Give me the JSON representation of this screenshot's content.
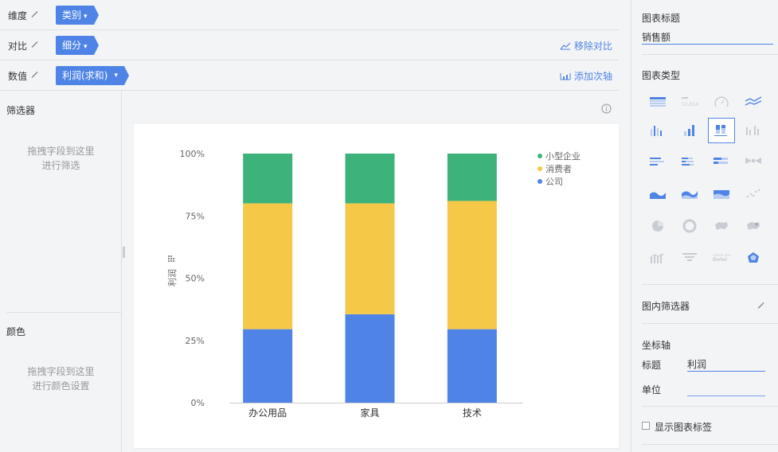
{
  "rows": {
    "dimension": {
      "label": "维度",
      "pill": "类别"
    },
    "compare": {
      "label": "对比",
      "pill": "细分",
      "action": "移除对比"
    },
    "value": {
      "label": "数值",
      "pill": "利润(求和)",
      "action": "添加次轴"
    }
  },
  "filter": {
    "title": "筛选器",
    "hint1": "拖拽字段到这里",
    "hint2": "进行筛选"
  },
  "color": {
    "title": "颜色",
    "hint1": "拖拽字段到这里",
    "hint2": "进行颜色设置"
  },
  "right": {
    "chart_title_label": "图表标题",
    "chart_title_value": "销售额",
    "chart_type_label": "图表类型",
    "inner_filter_label": "图内筛选器",
    "axis_label": "坐标轴",
    "axis_title_label": "标题",
    "axis_title_value": "利润",
    "unit_label": "单位",
    "unit_value": "",
    "show_labels": "显示图表标签",
    "chart_types": [
      "table",
      "kpi",
      "gauge",
      "line",
      "bar",
      "bar-grouped",
      "stacked-bar-100",
      "bar-dim",
      "hbar",
      "hbar-stacked",
      "hbar-100",
      "butterfly",
      "area",
      "area-stacked",
      "area-100",
      "scatter",
      "pie",
      "donut",
      "map",
      "map-bubble",
      "histogram",
      "funnel",
      "wordcloud",
      "radar"
    ],
    "selected_type": "stacked-bar-100"
  },
  "colors": {
    "accent": "#4f84e6",
    "green": "#3eb27b",
    "yellow": "#f5c848",
    "blue": "#4f84e6"
  },
  "chart_data": {
    "type": "bar",
    "stacked": true,
    "normalized": true,
    "categories": [
      "办公用品",
      "家具",
      "技术"
    ],
    "series": [
      {
        "name": "公司",
        "color": "#4f84e6",
        "values": [
          29.5,
          35.5,
          29.5
        ]
      },
      {
        "name": "消费者",
        "color": "#f5c848",
        "values": [
          50.5,
          44.5,
          51.5
        ]
      },
      {
        "name": "小型企业",
        "color": "#3eb27b",
        "values": [
          20,
          20,
          19
        ]
      }
    ],
    "ylabel": "利润",
    "yticks": [
      "0%",
      "25%",
      "50%",
      "75%",
      "100%"
    ],
    "ylim": [
      0,
      100
    ],
    "legend_position": "top-right",
    "legend_order": [
      "小型企业",
      "消费者",
      "公司"
    ]
  }
}
